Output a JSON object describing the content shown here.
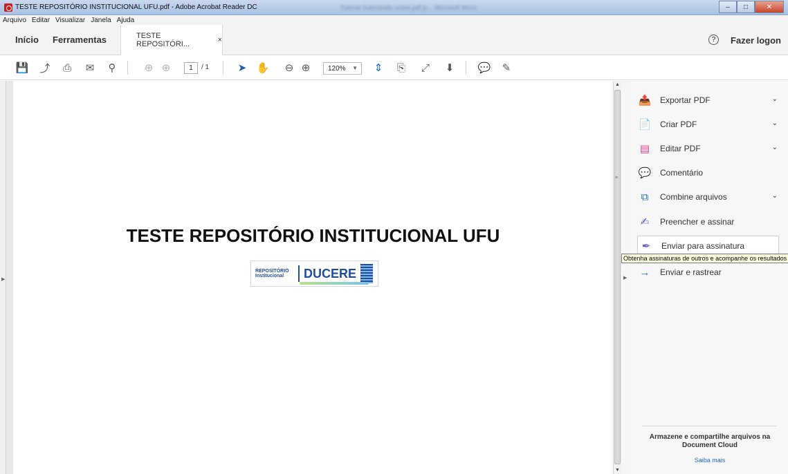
{
  "window": {
    "title": "TESTE REPOSITÓRIO INSTITUCIONAL UFU.pdf - Adobe Acrobat Reader DC",
    "background_title": "Tutorial Submissão sobre.pdf [c... Microsoft Word",
    "btn_minimize": "–",
    "btn_maximize": "□",
    "btn_close": "✕"
  },
  "menu": [
    "Arquivo",
    "Editar",
    "Visualizar",
    "Janela",
    "Ajuda"
  ],
  "tabs": {
    "home": "Início",
    "tools": "Ferramentas",
    "document": "TESTE REPOSITÓRI...",
    "close": "×",
    "help": "?",
    "logon": "Fazer logon"
  },
  "toolbar": {
    "icons": {
      "save": "💾",
      "upload": "⤴",
      "print": "⎙",
      "mail": "✉",
      "search": "⚲",
      "prev": "⊕",
      "next": "⊕",
      "select": "➤",
      "hand": "✋",
      "zoom_out": "⊖",
      "zoom_in": "⊕",
      "fit": "⇕",
      "rotate": "⎘",
      "fullscreen": "⤢",
      "scroll": "⬇",
      "comment": "💬",
      "sign": "✎"
    },
    "page_current": "1",
    "page_total": "/ 1",
    "zoom": "120%"
  },
  "document": {
    "heading": "TESTE REPOSITÓRIO INSTITUCIONAL UFU",
    "logo": {
      "line1": "REPOSITÓRIO",
      "line2": "Institucional",
      "name": "DUCERE"
    }
  },
  "right_pane": {
    "items": [
      {
        "label": "Exportar PDF",
        "icon": "📤",
        "color": "#2c9a52",
        "has_chevron": true
      },
      {
        "label": "Criar PDF",
        "icon": "📄",
        "color": "#e0412f",
        "has_chevron": true
      },
      {
        "label": "Editar PDF",
        "icon": "▤",
        "color": "#e0408a",
        "has_chevron": true
      },
      {
        "label": "Comentário",
        "icon": "💬",
        "color": "#f2b40e",
        "has_chevron": false
      },
      {
        "label": "Combine arquivos",
        "icon": "⧉",
        "color": "#1a6fd1",
        "has_chevron": true
      },
      {
        "label": "Preencher e assinar",
        "icon": "✍",
        "color": "#5b5fc7",
        "has_chevron": false
      },
      {
        "label": "Enviar para assinatura",
        "icon": "✒",
        "color": "#5b5fc7",
        "has_chevron": false
      },
      {
        "label": "Enviar e rastrear",
        "icon": "→",
        "color": "#1a6fd1",
        "has_chevron": false
      }
    ],
    "tooltip": "Obtenha assinaturas de outros e acompanhe os resultados",
    "cloud_text": "Armazene e compartilhe arquivos na Document Cloud",
    "cloud_link": "Saiba mais"
  }
}
